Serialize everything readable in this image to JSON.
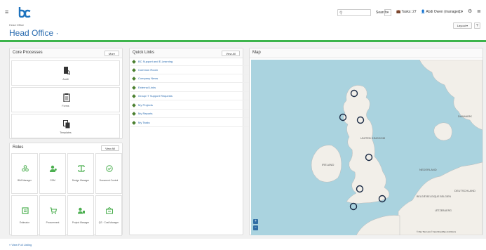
{
  "topbar": {
    "menu_icon": "hamburger-icon",
    "logo_icon": "bc-logo",
    "search_placeholder": "",
    "search_label": "Search",
    "search_dropdown": "▾",
    "tasks_label": "Tasks: 27",
    "user_label": "Abdi Owen (manager) ▾"
  },
  "header": {
    "breadcrumb": "Head Office",
    "title": "Head Office ·",
    "layout_btn": "Layout ▾",
    "help_btn": "?"
  },
  "core_processes": {
    "title": "Core Processes",
    "button": "More",
    "items": [
      {
        "label": "Audit",
        "icon": "audit-icon"
      },
      {
        "label": "Forms",
        "icon": "clipboard-icon"
      },
      {
        "label": "Templates",
        "icon": "copy-icon"
      }
    ]
  },
  "quick_links": {
    "title": "Quick Links",
    "button": "View All",
    "items": [
      "BC Support and E-Learning",
      "Common Room",
      "Company News",
      "External Links",
      "Group IT Support Requests",
      "My Projects",
      "My Reports",
      "My Tasks"
    ]
  },
  "roles": {
    "title": "Roles",
    "button": "View All",
    "items": [
      {
        "label": "BIM Manager",
        "icon": "network-icon"
      },
      {
        "label": "CDM",
        "icon": "users-icon"
      },
      {
        "label": "Design Manager",
        "icon": "design-icon"
      },
      {
        "label": "Document Control",
        "icon": "check-circle-icon"
      },
      {
        "label": "Estimator",
        "icon": "calculator-icon"
      },
      {
        "label": "Procurement",
        "icon": "cart-icon"
      },
      {
        "label": "Project Manager",
        "icon": "manager-icon"
      },
      {
        "label": "QS · Cost Manager",
        "icon": "cost-icon"
      }
    ]
  },
  "map": {
    "title": "Map",
    "labels": [
      "UNITED KINGDOM",
      "IRELAND",
      "DANMARK",
      "NEDERLAND",
      "BELGIË BELGIQUE BELGIEN",
      "DEUTSCHLAND",
      "LËTZEBUERG"
    ],
    "zoom_in": "+",
    "zoom_out": "−",
    "attribution": "© Map Tiles Here © OpenStreetMap contributors"
  },
  "footer": {
    "link": "« View Full Listing"
  },
  "colors": {
    "accent_green": "#3cb44b",
    "link_blue": "#2b6cb0",
    "role_green": "#4caf50"
  }
}
